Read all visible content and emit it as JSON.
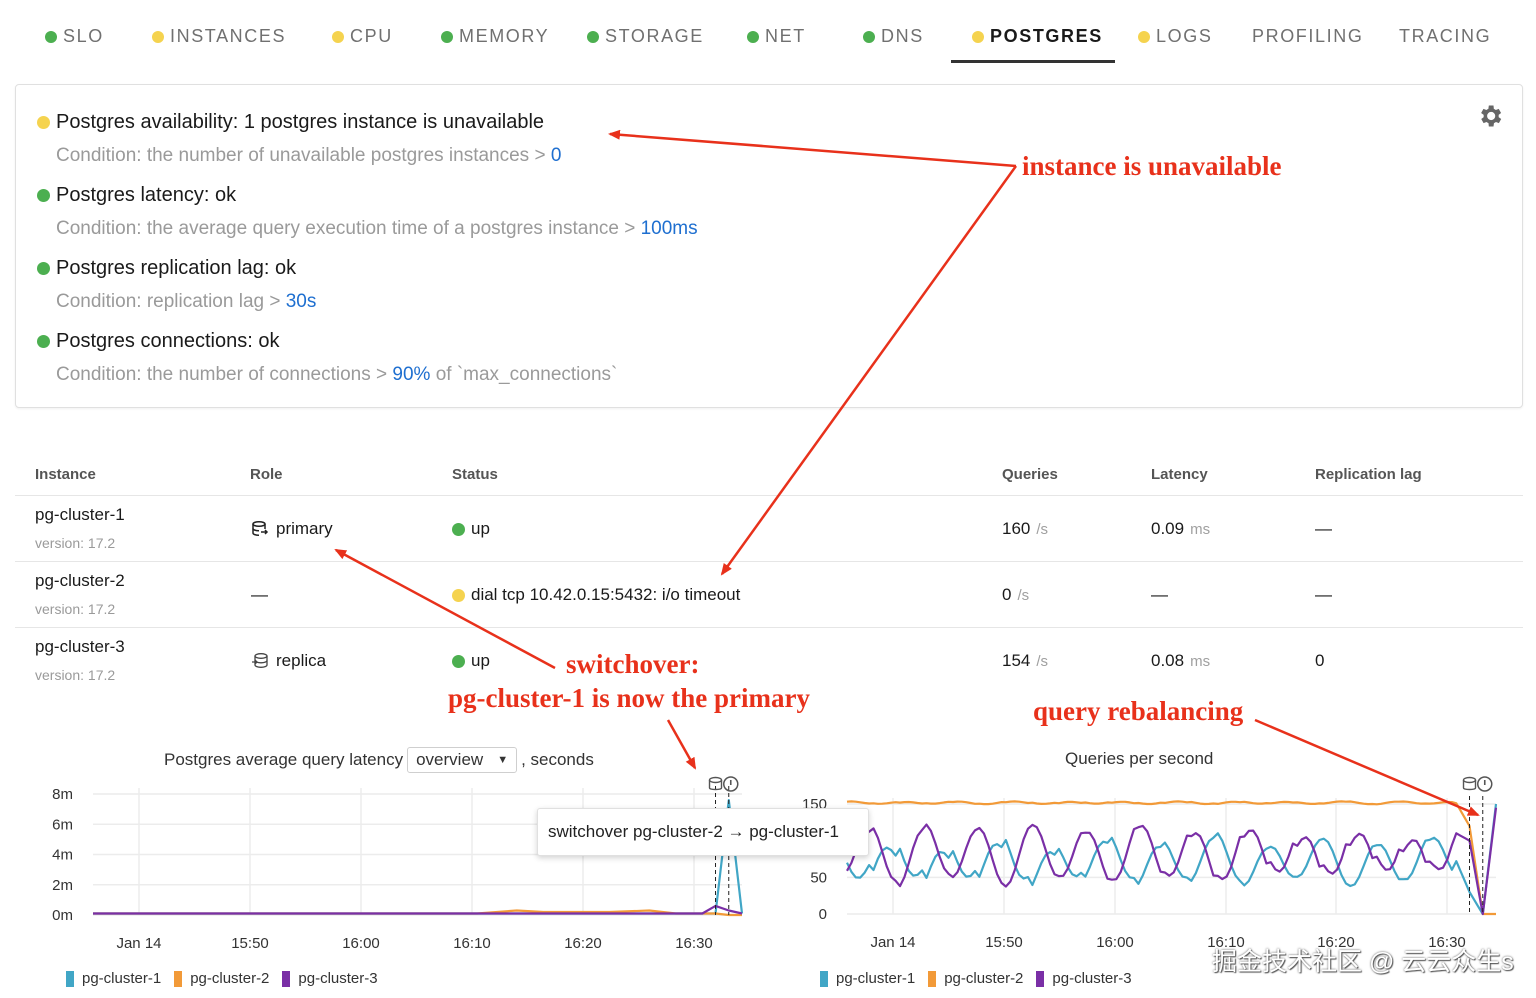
{
  "tabs": [
    {
      "label": "SLO",
      "status": "ok"
    },
    {
      "label": "INSTANCES",
      "status": "warning"
    },
    {
      "label": "CPU",
      "status": "warning"
    },
    {
      "label": "MEMORY",
      "status": "ok"
    },
    {
      "label": "STORAGE",
      "status": "ok"
    },
    {
      "label": "NET",
      "status": "ok"
    },
    {
      "label": "DNS",
      "status": "ok"
    },
    {
      "label": "POSTGRES",
      "status": "warning",
      "active": true
    },
    {
      "label": "LOGS",
      "status": "warning"
    },
    {
      "label": "PROFILING",
      "status": "none"
    },
    {
      "label": "TRACING",
      "status": "none"
    }
  ],
  "colors": {
    "ok": "#4caf50",
    "warning": "#f5d34f",
    "link_value": "#1e6fd0",
    "pg_cluster_1": "#41a6c6",
    "pg_cluster_2": "#f29a38",
    "pg_cluster_3": "#7a2fa6",
    "annotation": "#e8311b"
  },
  "checks": {
    "settings_icon": "gear-icon",
    "items": [
      {
        "status": "warning",
        "title": "Postgres availability: 1 postgres instance is unavailable",
        "condition": "Condition: the number of unavailable postgres instances > ",
        "threshold": "0",
        "suffix": ""
      },
      {
        "status": "ok",
        "title": "Postgres latency: ok",
        "condition": "Condition: the average query execution time of a postgres instance > ",
        "threshold": "100ms",
        "suffix": ""
      },
      {
        "status": "ok",
        "title": "Postgres replication lag: ok",
        "condition": "Condition: replication lag > ",
        "threshold": "30s",
        "suffix": ""
      },
      {
        "status": "ok",
        "title": "Postgres connections: ok",
        "condition": "Condition: the number of connections > ",
        "threshold": "90%",
        "suffix": " of `max_connections`"
      }
    ]
  },
  "table": {
    "headers": {
      "instance": "Instance",
      "role": "Role",
      "status": "Status",
      "queries": "Queries",
      "latency": "Latency",
      "replication_lag": "Replication lag"
    },
    "rows": [
      {
        "instance": "pg-cluster-1",
        "version": "version: 17.2",
        "role": "primary",
        "role_icon": "database-primary-icon",
        "status": "up",
        "status_color": "ok",
        "queries": "160",
        "queries_unit": "/s",
        "latency": "0.09",
        "latency_unit": "ms",
        "replication_lag": "—"
      },
      {
        "instance": "pg-cluster-2",
        "version": "version: 17.2",
        "role": "—",
        "role_icon": "",
        "status": "dial tcp 10.42.0.15:5432: i/o timeout",
        "status_color": "warning",
        "queries": "0",
        "queries_unit": "/s",
        "latency": "—",
        "latency_unit": "",
        "replication_lag": "—"
      },
      {
        "instance": "pg-cluster-3",
        "version": "version: 17.2",
        "role": "replica",
        "role_icon": "database-replica-icon",
        "status": "up",
        "status_color": "ok",
        "queries": "154",
        "queries_unit": "/s",
        "latency": "0.08",
        "latency_unit": "ms",
        "replication_lag": "0"
      }
    ]
  },
  "charts": {
    "latency_title_prefix": "Postgres average query latency",
    "latency_select": "overview",
    "latency_title_suffix": ", seconds",
    "qps_title": "Queries per second",
    "tooltip": "switchover pg-cluster-2 → pg-cluster-1"
  },
  "annotations": {
    "unavailable": "instance is unavailable",
    "switchover_1": "switchover:",
    "switchover_2": "pg-cluster-1 is now the primary",
    "rebalancing": "query rebalancing"
  },
  "watermark": "掘金技术社区 @ 云云众生s",
  "chart_data": [
    {
      "type": "line",
      "title": "Postgres average query latency",
      "ylabel": "seconds",
      "y_ticks": [
        "0m",
        "2m",
        "4m",
        "6m",
        "8m"
      ],
      "ylim": [
        0,
        0.008
      ],
      "x_ticks": [
        "Jan 14",
        "15:50",
        "16:00",
        "16:10",
        "16:20",
        "16:30"
      ],
      "x": [
        "15:46",
        "15:50",
        "15:55",
        "16:00",
        "16:05",
        "16:10",
        "16:15",
        "16:18",
        "16:20",
        "16:25",
        "16:28",
        "16:30",
        "16:32",
        "16:33",
        "16:34",
        "16:35"
      ],
      "series": [
        {
          "name": "pg-cluster-1",
          "values": [
            0.0001,
            0.0001,
            0.0001,
            0.0001,
            0.0001,
            0.0001,
            0.0001,
            0.0001,
            0.0001,
            0.0001,
            0.0001,
            0.0001,
            0.0001,
            0.0001,
            0.0076,
            0.0001
          ]
        },
        {
          "name": "pg-cluster-2",
          "values": [
            0.0001,
            0.0001,
            0.0001,
            0.0001,
            0.0001,
            0.0001,
            0.0001,
            0.0003,
            0.0002,
            0.0002,
            0.0003,
            0.0001,
            0.0001,
            0.0001,
            0,
            0
          ]
        },
        {
          "name": "pg-cluster-3",
          "values": [
            0.0001,
            0.0001,
            0.0001,
            0.0001,
            0.0001,
            0.0001,
            0.0001,
            0.0001,
            0.0001,
            0.0001,
            0.0001,
            0.0001,
            0.0001,
            0.0006,
            0.0003,
            0.0001
          ]
        }
      ],
      "legend": "bottom"
    },
    {
      "type": "line",
      "title": "Queries per second",
      "y_ticks": [
        "0",
        "50",
        "150"
      ],
      "ylim": [
        0,
        150
      ],
      "x_ticks": [
        "Jan 14",
        "15:50",
        "16:00",
        "16:10",
        "16:20",
        "16:30"
      ],
      "x": [
        "15:46",
        "15:48",
        "15:50",
        "15:52",
        "15:54",
        "15:56",
        "15:58",
        "16:00",
        "16:02",
        "16:04",
        "16:06",
        "16:08",
        "16:10",
        "16:12",
        "16:14",
        "16:16",
        "16:18",
        "16:20",
        "16:22",
        "16:24",
        "16:26",
        "16:28",
        "16:30",
        "16:32",
        "16:33",
        "16:34",
        "16:35"
      ],
      "series": [
        {
          "name": "pg-cluster-1",
          "values": [
            70,
            62,
            85,
            55,
            78,
            60,
            90,
            52,
            75,
            66,
            88,
            58,
            80,
            63,
            92,
            57,
            74,
            68,
            86,
            54,
            79,
            61,
            89,
            72,
            30,
            0,
            150
          ]
        },
        {
          "name": "pg-cluster-2",
          "values": [
            152,
            152,
            151,
            152,
            152,
            151,
            152,
            152,
            151,
            152,
            152,
            151,
            152,
            152,
            151,
            152,
            152,
            151,
            152,
            152,
            151,
            152,
            152,
            151,
            120,
            0,
            0
          ]
        },
        {
          "name": "pg-cluster-3",
          "values": [
            80,
            95,
            60,
            100,
            72,
            96,
            58,
            102,
            70,
            94,
            62,
            105,
            68,
            97,
            59,
            101,
            73,
            93,
            64,
            99,
            71,
            95,
            60,
            110,
            100,
            0,
            145
          ]
        }
      ],
      "legend": "bottom"
    }
  ]
}
